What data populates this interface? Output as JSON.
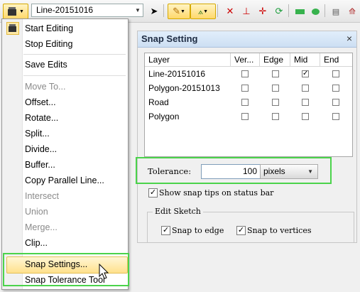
{
  "toolbar": {
    "layer_selected": "Line-20151016",
    "icons": [
      "editor-icon",
      "dropdown-icon",
      "combo-arrow",
      "edit-cursor-icon",
      "sketch-pencil-icon",
      "snap-icon",
      "delete-vertex-icon",
      "perpendicular-icon",
      "move-icon",
      "rotate-icon",
      "rectangle-icon",
      "ellipse-icon",
      "attributes-icon",
      "sketch-properties-icon"
    ]
  },
  "menu": {
    "items": [
      {
        "label": "Start Editing",
        "enabled": true
      },
      {
        "label": "Stop Editing",
        "enabled": true
      },
      {
        "label": "Save Edits",
        "enabled": true
      },
      {
        "label": "Move To...",
        "enabled": false
      },
      {
        "label": "Offset...",
        "enabled": true
      },
      {
        "label": "Rotate...",
        "enabled": true
      },
      {
        "label": "Split...",
        "enabled": true
      },
      {
        "label": "Divide...",
        "enabled": true
      },
      {
        "label": "Buffer...",
        "enabled": true
      },
      {
        "label": "Copy Parallel Line...",
        "enabled": true
      },
      {
        "label": "Intersect",
        "enabled": false
      },
      {
        "label": "Union",
        "enabled": false
      },
      {
        "label": "Merge...",
        "enabled": false
      },
      {
        "label": "Clip...",
        "enabled": true
      },
      {
        "label": "Snap Settings...",
        "enabled": true,
        "highlighted": true
      },
      {
        "label": "Snap Tolerance Tool",
        "enabled": true
      }
    ]
  },
  "dialog": {
    "title": "Snap Setting",
    "close": "×",
    "columns": [
      "Layer",
      "Ver...",
      "Edge",
      "Mid",
      "End"
    ],
    "rows": [
      {
        "layer": "Line-20151016",
        "vertex": false,
        "edge": false,
        "mid": true,
        "end": false
      },
      {
        "layer": "Polygon-20151013",
        "vertex": false,
        "edge": false,
        "mid": false,
        "end": false
      },
      {
        "layer": "Road",
        "vertex": false,
        "edge": false,
        "mid": false,
        "end": false
      },
      {
        "layer": "Polygon",
        "vertex": false,
        "edge": false,
        "mid": false,
        "end": false
      }
    ],
    "tolerance_label": "Tolerance:",
    "tolerance_value": "100",
    "tolerance_units": "pixels",
    "show_snap_tips": {
      "label": "Show snap tips on status bar",
      "checked": true
    },
    "edit_sketch_legend": "Edit Sketch",
    "snap_to_edge": {
      "label": "Snap to edge",
      "checked": true
    },
    "snap_to_vertices": {
      "label": "Snap to vertices",
      "checked": true
    }
  }
}
